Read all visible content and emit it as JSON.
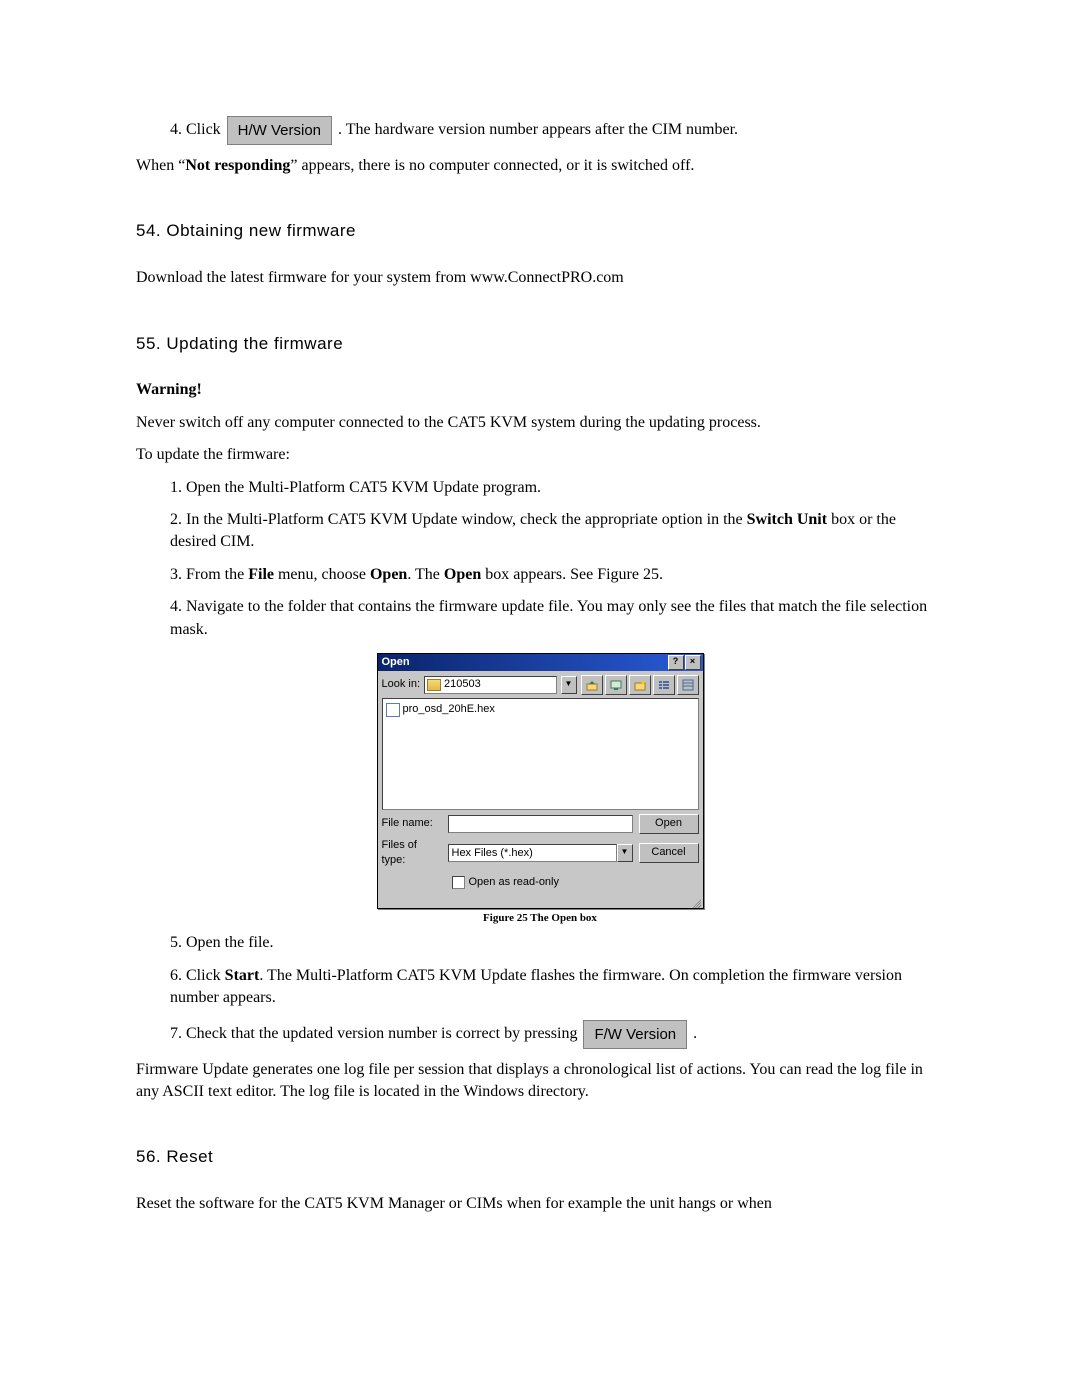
{
  "step4": {
    "prefix": "4. Click ",
    "button": "H/W Version",
    "suffix": ". The hardware version number appears after the CIM number."
  },
  "not_responding_line": {
    "prefix": "When “",
    "bold": "Not responding",
    "suffix": "” appears, there is no computer connected, or it is switched off."
  },
  "sec54": {
    "heading": "54. Obtaining new firmware",
    "body": "Download the latest firmware for your system from www.ConnectPRO.com"
  },
  "sec55": {
    "heading": "55. Updating the firmware",
    "warning": "Warning!",
    "never": "Never switch off any computer connected to the CAT5 KVM system during the updating process.",
    "to_update": "To update the firmware:",
    "items": {
      "i1": "1. Open the Multi-Platform CAT5 KVM Update program.",
      "i2_prefix": "2. In the Multi-Platform CAT5 KVM Update window, check the appropriate option in the ",
      "i2_bold": "Switch Unit",
      "i2_suffix": " box or the desired CIM.",
      "i3_a": "3. From the ",
      "i3_file": "File",
      "i3_b": " menu, choose ",
      "i3_open1": "Open",
      "i3_c": ". The ",
      "i3_open2": "Open",
      "i3_d": " box appears. See Figure 25.",
      "i4": "4. Navigate to the folder that contains the firmware update file. You may only see the files that match the file selection mask.",
      "i5": "5. Open the file.",
      "i6_a": "6. Click ",
      "i6_start": "Start",
      "i6_b": ". The Multi-Platform CAT5 KVM Update flashes the firmware. On completion the firmware version number appears.",
      "i7_a": "7. Check that the updated version number is correct by pressing ",
      "i7_btn": "F/W Version",
      "i7_b": "."
    },
    "logline": "Firmware Update generates one log file per session that displays a chronological list of actions. You can read the log file in any ASCII text editor. The log file is located in the Windows directory.",
    "figure_caption": "Figure 25 The Open box"
  },
  "sec56": {
    "heading": "56. Reset",
    "body": "Reset the software for the CAT5 KVM Manager or CIMs when for example the unit hangs or when"
  },
  "dialog": {
    "title": "Open",
    "lookin_label": "Look in:",
    "lookin_value": "210503",
    "file_item": "pro_osd_20hE.hex",
    "filename_label": "File name:",
    "filename_value": "",
    "filetype_label": "Files of type:",
    "filetype_value": "Hex Files (*.hex)",
    "open_btn": "Open",
    "cancel_btn": "Cancel",
    "readonly_label": "Open as read-only",
    "help_btn": "?",
    "close_btn": "×"
  }
}
